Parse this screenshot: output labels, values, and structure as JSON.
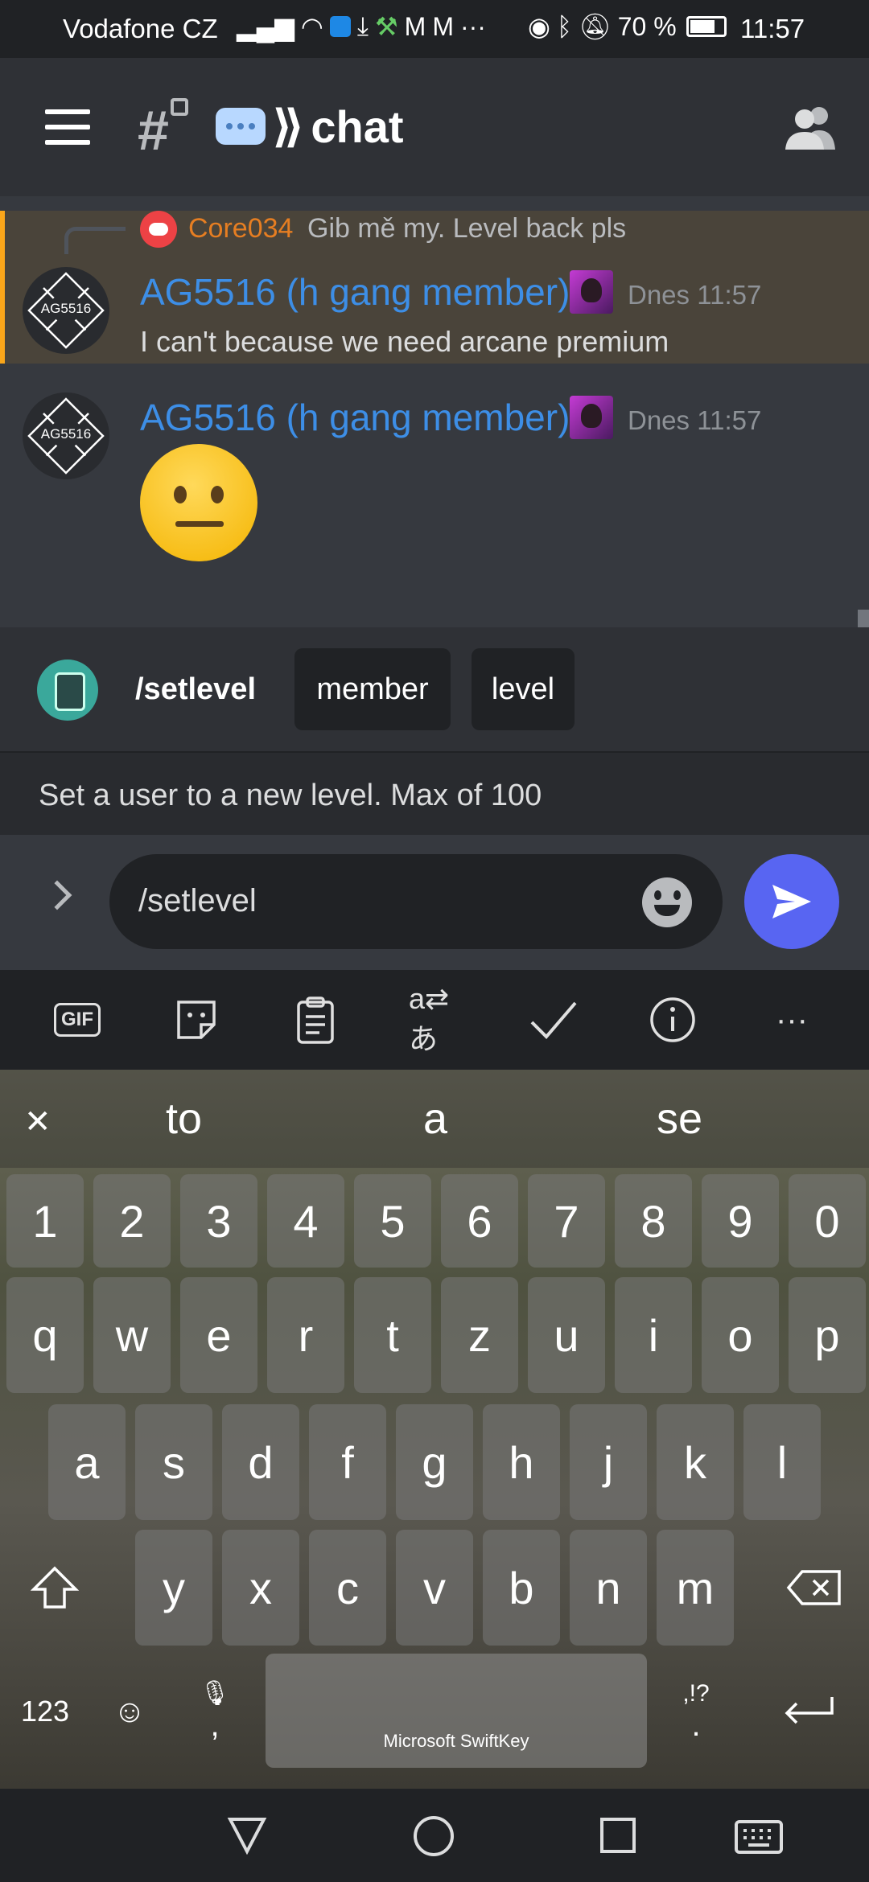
{
  "status_bar": {
    "carrier": "Vodafone CZ",
    "battery": "70 %",
    "time": "11:57",
    "icons": [
      "signal-icon",
      "wifi-icon",
      "shield-app-icon",
      "download-icon",
      "pickaxe-icon",
      "gmail-icon",
      "gmail-icon",
      "more-icon",
      "eye-icon",
      "bluetooth-icon",
      "mute-bell-icon",
      "battery-icon"
    ]
  },
  "app_bar": {
    "channel_name": "chat",
    "icons": [
      "menu-icon",
      "locked-channel-icon",
      "speech-bubble-emoji",
      "members-icon"
    ]
  },
  "messages": [
    {
      "reply": {
        "author": "Core034",
        "text": "Gib mě my. Level back pls"
      },
      "avatar_text": "AG5516",
      "author": "AG5516 (h gang member)",
      "timestamp": "Dnes 11:57",
      "text": "I can't because we need arcane premium",
      "highlighted": true
    },
    {
      "avatar_text": "AG5516",
      "author": "AG5516 (h gang member)",
      "timestamp": "Dnes 11:57",
      "emoji": "neutral-face"
    }
  ],
  "command": {
    "name": "/setlevel",
    "options": [
      "member",
      "level"
    ],
    "description": "Set a user to a new level. Max of 100"
  },
  "composer": {
    "value": "/setlevel"
  },
  "keyboard": {
    "toolbar": [
      "gif-icon",
      "sticker-icon",
      "clipboard-icon",
      "translate-icon",
      "checkmark-icon",
      "info-icon",
      "more-icon"
    ],
    "gif_label": "GIF",
    "suggestions": [
      "to",
      "a",
      "se"
    ],
    "rows": [
      [
        "1",
        "2",
        "3",
        "4",
        "5",
        "6",
        "7",
        "8",
        "9",
        "0"
      ],
      [
        "q",
        "w",
        "e",
        "r",
        "t",
        "z",
        "u",
        "i",
        "o",
        "p"
      ],
      [
        "a",
        "s",
        "d",
        "f",
        "g",
        "h",
        "j",
        "k",
        "l"
      ],
      [
        "y",
        "x",
        "c",
        "v",
        "b",
        "n",
        "m"
      ]
    ],
    "mode_key": "123",
    "comma": ",",
    "space_label": "Microsoft SwiftKey",
    "punct_top": ",!?",
    "punct_bottom": "."
  },
  "colors": {
    "accent": "#5865f2",
    "author": "#3d8ee6",
    "reply_author": "#e67e22",
    "highlight_bar": "#faa61a"
  }
}
